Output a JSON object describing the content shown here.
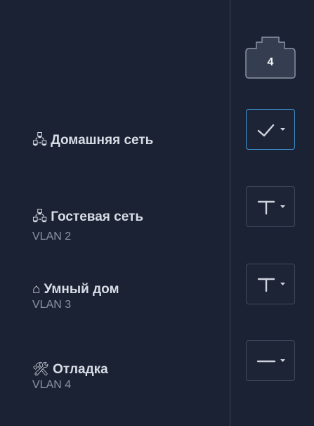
{
  "port": {
    "number": "4"
  },
  "rows": [
    {
      "icon": "network-icon",
      "glyph": "🖧",
      "title": "Домашняя сеть",
      "subtitle": "",
      "mode": "untagged",
      "selected": true
    },
    {
      "icon": "network-icon",
      "glyph": "🖧",
      "title": "Гостевая сеть",
      "subtitle": "VLAN 2",
      "mode": "tagged",
      "selected": false
    },
    {
      "icon": "home-icon",
      "glyph": "⌂",
      "title": "Умный дом",
      "subtitle": "VLAN 3",
      "mode": "tagged",
      "selected": false
    },
    {
      "icon": "tools-icon",
      "glyph": "🛠",
      "title": "Отладка",
      "subtitle": "VLAN 4",
      "mode": "excluded",
      "selected": false
    }
  ],
  "colors": {
    "background": "#1b2233",
    "accent": "#3f96d8",
    "border": "#414a5c",
    "text": "#d8dde6",
    "muted": "#8a93a4"
  }
}
